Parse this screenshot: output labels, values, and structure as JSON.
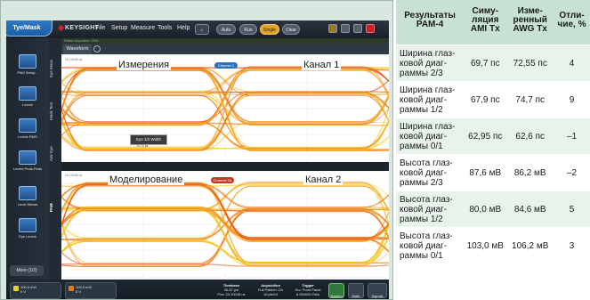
{
  "app": {
    "brand_label": "KEYSIGHT",
    "menu": [
      "File",
      "Setup",
      "Measure",
      "Tools",
      "Help"
    ],
    "pills": [
      "Auto Scale",
      "Run",
      "Single",
      "Clear"
    ],
    "tyemask_label": "Tye/Mask",
    "status_strip": "Pattern Acquisition  100%"
  },
  "sidebar": {
    "items": [
      "PAM Setup...",
      "Levels",
      "Levels RMS",
      "Levels Peak-Peak",
      "Level Skews",
      "Eye Levels"
    ],
    "more_label": "More (1/2)"
  },
  "vtabs": [
    "Eye Meas",
    "Mask Test",
    "Adv Eye",
    "PAM"
  ],
  "waveform": {
    "tab_label": "Waveform",
    "eye1": {
      "caption_left": "Измерения",
      "caption_right": "Канал 1",
      "badge": "Channel 1",
      "scale": "24.10048 ns",
      "marker": "Eye 1/2 Width",
      "marker_value": "74.70 ps"
    },
    "eye2": {
      "caption_left": "Моделирование",
      "caption_right": "Канал 2",
      "badge": "Channel 2A",
      "scale": "24.10048 ns"
    }
  },
  "bottom": {
    "chips": [
      {
        "line1": "100.0 mV/",
        "line2": "0 V",
        "color": "#e6d02a"
      },
      {
        "line1": "100.0 mV/",
        "line2": "0 V",
        "color": "#e07a1a"
      }
    ],
    "timebase": {
      "title": "Timebase",
      "line1": "26.67 ps/",
      "line2": "Pos: 24.10048 ns"
    },
    "acquisition": {
      "title": "Acquisition",
      "line1": "Full Pattern: On",
      "line2": "16 pts/UI"
    },
    "trigger": {
      "title": "Trigger",
      "line1": "Src: Front Panel",
      "line2": "6.250000 Gb/s"
    },
    "buttons": [
      "System",
      "Math",
      "Signals"
    ]
  },
  "table": {
    "headers": [
      "Результаты PAM-4",
      "Симу-ляция AMI Tx",
      "Изме-ренный AWG Tx",
      "Отли-чие, %"
    ],
    "rows": [
      {
        "name": "Ширина глаз-ковой диаг-раммы 2/3",
        "sim": "69,7 пс",
        "meas": "72,55 пс",
        "diff": "4"
      },
      {
        "name": "Ширина глаз-ковой диаг-раммы 1/2",
        "sim": "67,9 пс",
        "meas": "74,7 пс",
        "diff": "9"
      },
      {
        "name": "Ширина глаз-ковой диаг-раммы 0/1",
        "sim": "62,95 пс",
        "meas": "62,6 пс",
        "diff": "–1"
      },
      {
        "name": "Высота глаз-ковой диаг-раммы 2/3",
        "sim": "87,6 мВ",
        "meas": "86,2 мВ",
        "diff": "–2"
      },
      {
        "name": "Высота глаз-ковой диаг-раммы 1/2",
        "sim": "80,0 мВ",
        "meas": "84,6 мВ",
        "diff": "5"
      },
      {
        "name": "Высота глаз-ковой диаг-раммы 0/1",
        "sim": "103,0 мВ",
        "meas": "106,2 мВ",
        "diff": "3"
      }
    ]
  }
}
